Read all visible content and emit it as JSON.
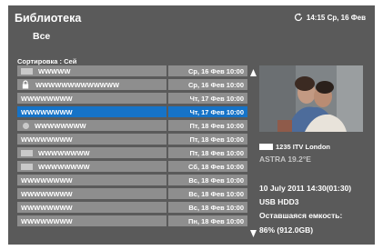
{
  "header": {
    "title": "Библиотека",
    "subtitle": "Все",
    "clock": "14:15 Ср, 16 Фев"
  },
  "sort_label": "Сортировка : Сей",
  "recordings": [
    {
      "name": "WWWWW",
      "date": "Ср, 16 Фев 10:00",
      "icon": "folder-icon",
      "selected": false
    },
    {
      "name": "WWWWWWWWWWWWW",
      "date": "Ср, 16 Фев 10:00",
      "icon": "lock-icon",
      "selected": false
    },
    {
      "name": "WWWWWWWW",
      "date": "Чт, 17 Фев 10:00",
      "icon": "",
      "selected": false
    },
    {
      "name": "WWWWWWWW",
      "date": "Чт, 17 Фев 10:00",
      "icon": "",
      "selected": true
    },
    {
      "name": "WWWWWWWW",
      "date": "Пт, 18 Фев 10:00",
      "icon": "dot-icon",
      "selected": false
    },
    {
      "name": "WWWWWWWW",
      "date": "Пт, 18 Фев 10:00",
      "icon": "",
      "selected": false
    },
    {
      "name": "WWWWWWWW",
      "date": "Пт, 18 Фев 10:00",
      "icon": "folder-icon",
      "selected": false
    },
    {
      "name": "WWWWWWWW",
      "date": "Сб, 18 Фев 10:00",
      "icon": "folder-icon",
      "selected": false
    },
    {
      "name": "WWWWWWWW",
      "date": "Вс, 18 Фев 10:00",
      "icon": "",
      "selected": false
    },
    {
      "name": "WWWWWWWW",
      "date": "Вс, 18 Фев 10:00",
      "icon": "",
      "selected": false
    },
    {
      "name": "WWWWWWWW",
      "date": "Вс, 18 Фев 10:00",
      "icon": "",
      "selected": false
    },
    {
      "name": "WWWWWWWW",
      "date": "Пн, 18 Фев 10:00",
      "icon": "",
      "selected": false
    }
  ],
  "details": {
    "channel": "1235 ITV London",
    "satellite": "ASTRA 19.2°E",
    "datetime": "10 July 2011  14:30(01:30)",
    "storage": "USB HDD3",
    "capacity_label": "Оставшаяся емкость:",
    "capacity_value": "86% (912.0GB)"
  },
  "colors": {
    "background": "#5a5a5a",
    "row": "#8e8e8e",
    "selected_row": "#1673c7"
  }
}
